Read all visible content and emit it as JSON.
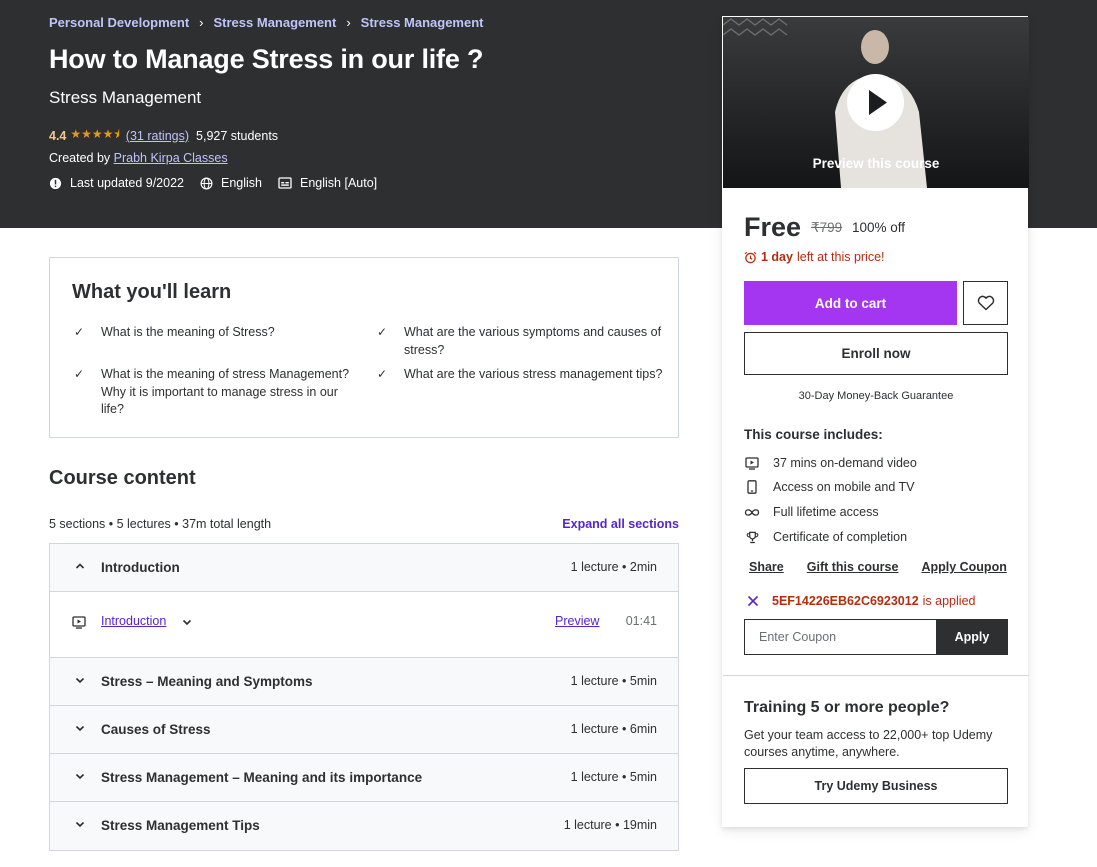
{
  "breadcrumb": [
    "Personal Development",
    "Stress Management",
    "Stress Management"
  ],
  "course": {
    "title": "How to Manage Stress in our life ?",
    "subtitle": "Stress Management",
    "rating": "4.4",
    "stars_icon": "star-rating-4.5",
    "ratings_link": "(31 ratings)",
    "students": "5,927 students",
    "created_by_label": "Created by",
    "instructor": "Prabh Kirpa Classes",
    "last_updated": "Last updated 9/2022",
    "language": "English",
    "captions": "English [Auto]"
  },
  "learn": {
    "title": "What you'll learn",
    "items": [
      "What is the meaning of Stress?",
      "What are the various symptoms and causes of stress?",
      "What is the meaning of stress Management? Why it is important to manage stress in our life?",
      "What are the various stress management tips?"
    ]
  },
  "content": {
    "title": "Course content",
    "summary": "5 sections • 5 lectures • 37m total length",
    "expand_all": "Expand all sections",
    "sections": [
      {
        "name": "Introduction",
        "meta": "1 lecture • 2min",
        "expanded": true
      },
      {
        "name": "Stress – Meaning and Symptoms",
        "meta": "1 lecture • 5min",
        "expanded": false
      },
      {
        "name": "Causes of Stress",
        "meta": "1 lecture • 6min",
        "expanded": false
      },
      {
        "name": "Stress Management – Meaning and its importance",
        "meta": "1 lecture • 5min",
        "expanded": false
      },
      {
        "name": "Stress Management Tips",
        "meta": "1 lecture • 19min",
        "expanded": false
      }
    ],
    "lecture": {
      "name": "Introduction",
      "preview": "Preview",
      "duration": "01:41"
    }
  },
  "card": {
    "preview_label": "Preview this course",
    "price": "Free",
    "original_price": "₹799",
    "discount": "100% off",
    "timer_bold": "1 day",
    "timer_rest": "left at this price!",
    "add_to_cart": "Add to cart",
    "enroll_now": "Enroll now",
    "guarantee": "30-Day Money-Back Guarantee",
    "includes_title": "This course includes:",
    "includes": [
      {
        "icon": "video-icon",
        "text": "37 mins on-demand video"
      },
      {
        "icon": "mobile-icon",
        "text": "Access on mobile and TV"
      },
      {
        "icon": "infinity-icon",
        "text": "Full lifetime access"
      },
      {
        "icon": "trophy-icon",
        "text": "Certificate of completion"
      }
    ],
    "share": "Share",
    "gift": "Gift this course",
    "apply_coupon": "Apply Coupon",
    "coupon_code": "5EF14226EB62C6923012",
    "coupon_applied_suffix": "is applied",
    "coupon_placeholder": "Enter Coupon",
    "apply_button": "Apply",
    "training_title": "Training 5 or more people?",
    "training_desc": "Get your team access to 22,000+ top Udemy courses anytime, anywhere.",
    "business_button": "Try Udemy Business"
  },
  "colors": {
    "hero_bg": "#2d2f31",
    "accent_purple": "#a435f0",
    "link_purple": "#5624d0",
    "star": "#e59819",
    "alert_red": "#b32d0f"
  }
}
